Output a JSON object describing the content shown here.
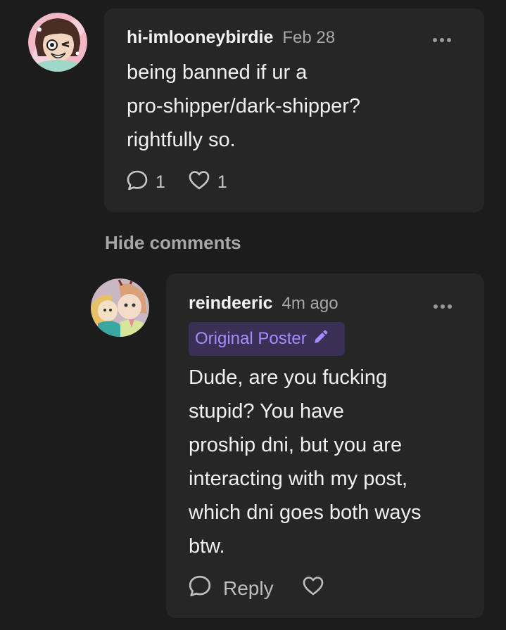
{
  "comment": {
    "avatar": "avatar-cartoon-character",
    "username": "hi-imlooneybirdie",
    "timestamp": "Feb 28",
    "more_icon": "more-horizontal-icon",
    "body_lines": [
      "being banned if ur a",
      "pro-shipper/dark-shipper?",
      "rightfully so."
    ],
    "reply_count": "1",
    "like_count": "1",
    "reply_icon": "speech-bubble-icon",
    "like_icon": "heart-icon"
  },
  "thread": {
    "hide_comments_label": "Hide comments"
  },
  "reply": {
    "avatar": "avatar-cartoon-characters",
    "username": "reindeeric",
    "timestamp": "4m ago",
    "more_icon": "more-horizontal-icon",
    "badge_label": "Original Poster",
    "badge_icon": "pencil-icon",
    "body_lines": [
      "Dude, are you fucking",
      "stupid? You have",
      "proship dni, but you are",
      "interacting with my post,",
      "which dni goes both ways",
      "btw."
    ],
    "reply_label": "Reply",
    "reply_icon": "speech-bubble-icon",
    "like_icon": "heart-icon"
  },
  "colors": {
    "background": "#1c1c1c",
    "card": "#262626",
    "badge_bg": "#3a2f54",
    "badge_text": "#a98bff",
    "muted": "#a8a8a8"
  }
}
